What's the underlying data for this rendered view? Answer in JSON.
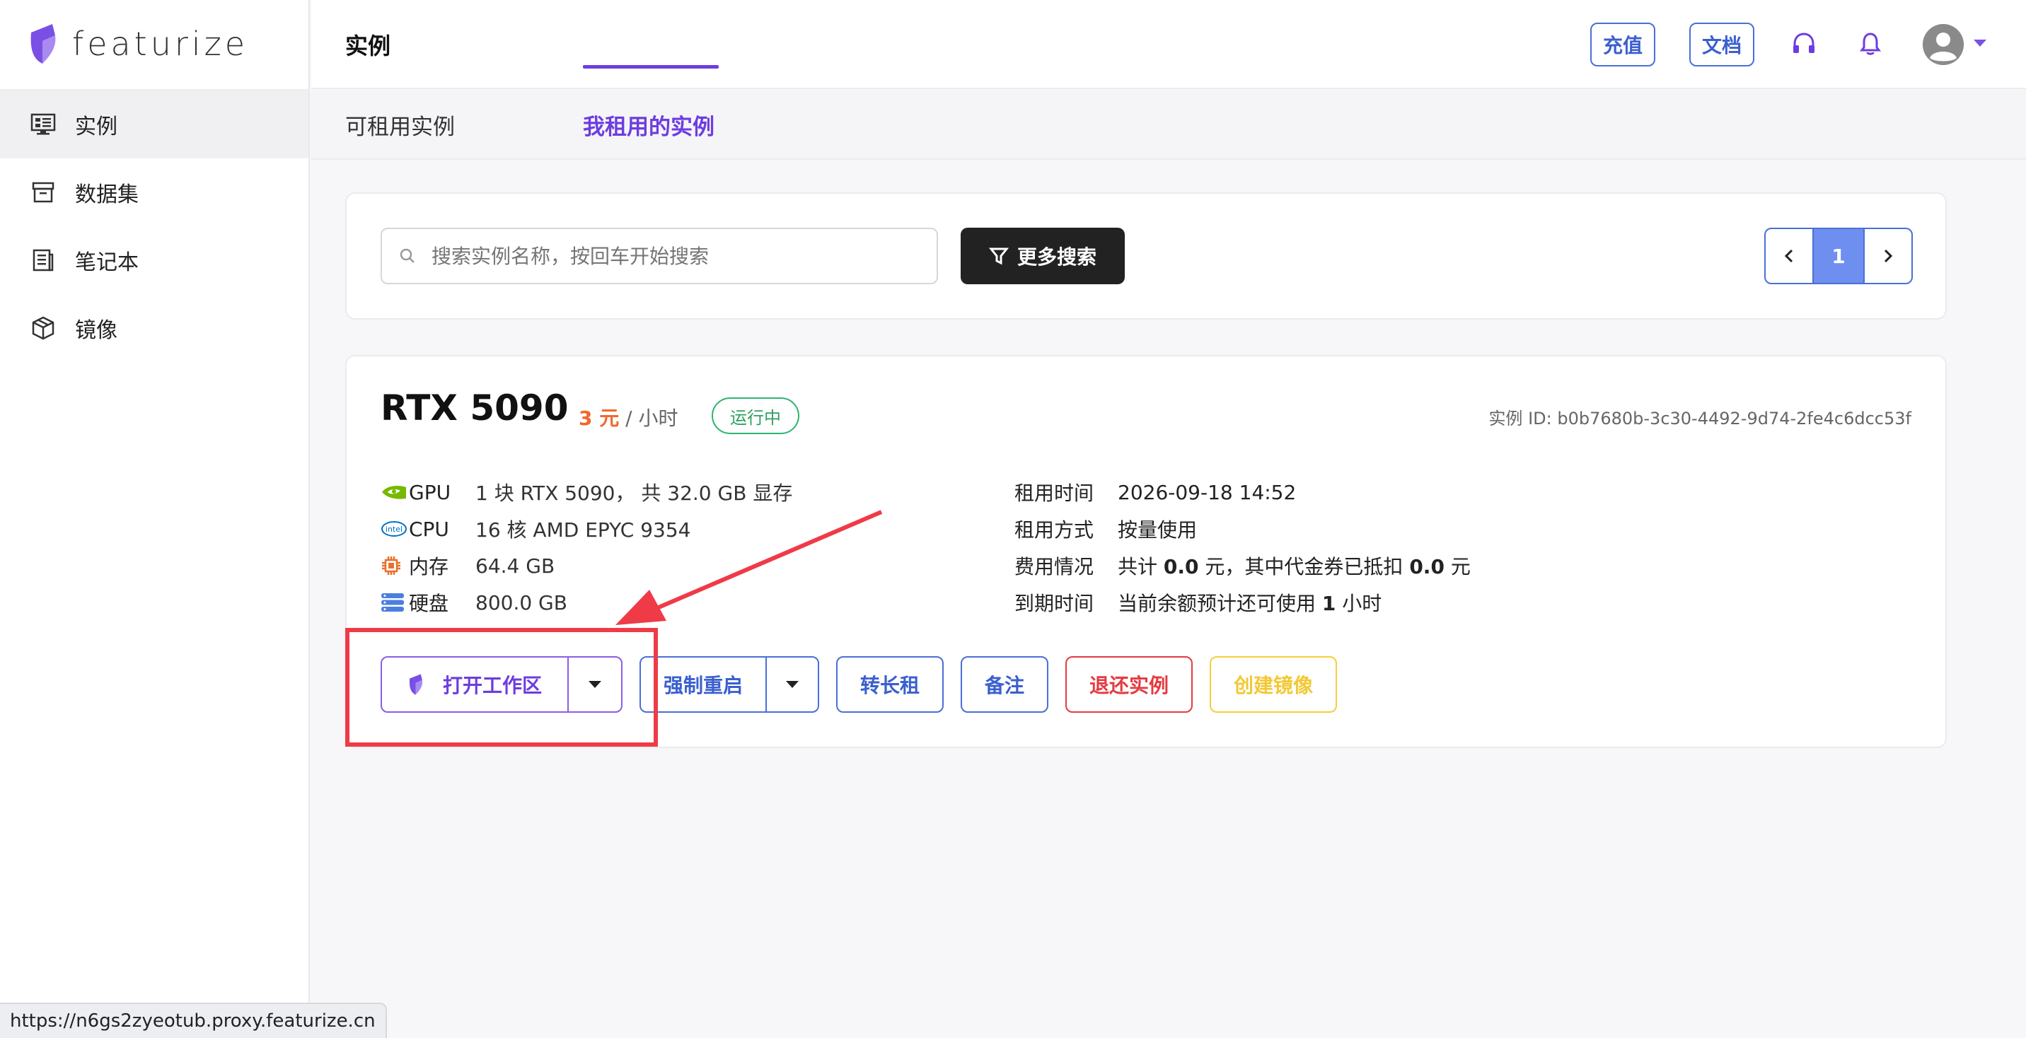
{
  "app": {
    "name": "Featurize",
    "logo_text": "featurize"
  },
  "sidebar": {
    "items": [
      {
        "label": "实例",
        "icon": "dashboard-icon",
        "active": true
      },
      {
        "label": "数据集",
        "icon": "archive-box-icon",
        "active": false
      },
      {
        "label": "笔记本",
        "icon": "notebook-icon",
        "active": false
      },
      {
        "label": "镜像",
        "icon": "cube-icon",
        "active": false
      }
    ]
  },
  "header": {
    "title": "实例",
    "recharge_label": "充值",
    "docs_label": "文档",
    "support_icon": "headset-icon",
    "notification_icon": "bell-icon",
    "avatar_icon": "user-avatar-icon"
  },
  "tabs": [
    {
      "label": "可租用实例",
      "active": false
    },
    {
      "label": "我租用的实例",
      "active": true
    }
  ],
  "search": {
    "placeholder": "搜索实例名称，按回车开始搜索",
    "more_label": "更多搜索"
  },
  "pagination": {
    "current": "1"
  },
  "instance": {
    "name": "RTX 5090",
    "price_value": "3 元",
    "price_unit": " / 小时",
    "status": "运行中",
    "id_label": "实例 ID: b0b7680b-3c30-4492-9d74-2fe4c6dcc53f",
    "specs": [
      {
        "icon": "nvidia-icon",
        "label": "GPU",
        "value": "1 块 RTX 5090， 共 32.0 GB 显存"
      },
      {
        "icon": "intel-icon",
        "label": "CPU",
        "value": "16 核 AMD EPYC 9354"
      },
      {
        "icon": "memory-chip-icon",
        "label": "内存",
        "value": "64.4 GB"
      },
      {
        "icon": "storage-icon",
        "label": "硬盘",
        "value": "800.0 GB"
      }
    ],
    "rental": {
      "time_label": "租用时间",
      "time_value": "2026-09-18 14:52",
      "mode_label": "租用方式",
      "mode_value": "按量使用",
      "cost_label": "费用情况",
      "cost_pre": "共计 ",
      "cost_total": "0.0",
      "cost_mid": " 元，其中代金券已抵扣 ",
      "cost_voucher": "0.0",
      "cost_post": " 元",
      "expire_label": "到期时间",
      "expire_pre": "当前余额预计还可使用 ",
      "expire_hours": "1",
      "expire_post": " 小时"
    },
    "actions": {
      "open_workspace": "打开工作区",
      "force_restart": "强制重启",
      "long_term": "转长租",
      "note": "备注",
      "return": "退还实例",
      "create_image": "创建镜像"
    }
  },
  "colors": {
    "accent": "#6d3de0",
    "blue": "#4a6fd8",
    "danger": "#e53a40",
    "warning": "#f5cf3a",
    "success": "#2fb36e",
    "price": "#f0682a"
  },
  "status_bar": {
    "url": "https://n6gs2zyeotub.proxy.featurize.cn"
  }
}
